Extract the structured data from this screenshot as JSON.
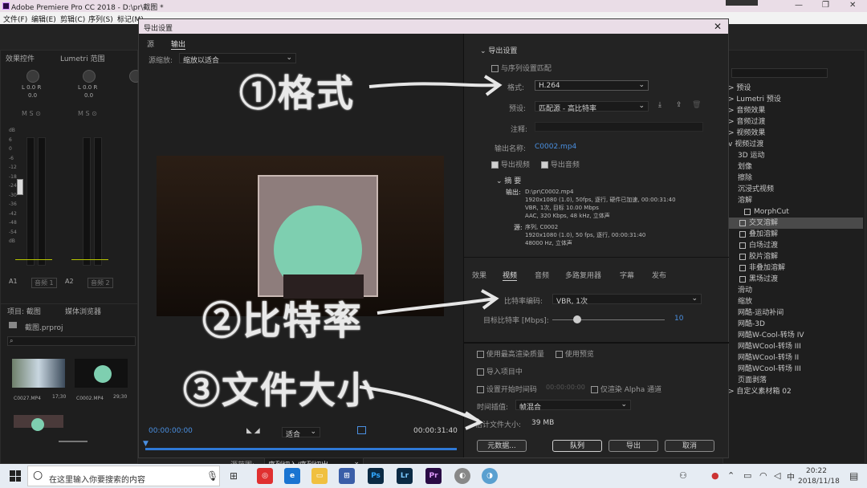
{
  "window": {
    "title": "Adobe Premiere Pro CC 2018 - D:\\pr\\截图 *"
  },
  "menu": [
    "文件(F)",
    "编辑(E)",
    "剪辑(C)",
    "序列(S)",
    "标记(M)"
  ],
  "left_panel": {
    "tabs": [
      "效果控件",
      "Lumetri 范围"
    ],
    "channels": [
      {
        "knob": "L 0.0 R",
        "value": "0.0",
        "label": "A1",
        "btn": "音频 1"
      },
      {
        "knob": "L 0.0 R",
        "value": "0.0",
        "label": "A2",
        "btn": "音频 2"
      },
      {
        "knob": "L 0.0 R",
        "value": "0.0",
        "label": "",
        "btn": ""
      }
    ],
    "db_scale": [
      "dB",
      "6",
      "0",
      "-6",
      "-12",
      "-18",
      "-24",
      "-30",
      "-36",
      "-42",
      "-48",
      "-54",
      "dB"
    ],
    "project_tabs": [
      "项目: 截图",
      "媒体浏览器"
    ],
    "project_name": "截图.prproj",
    "thumbs": [
      {
        "name": "C0027.MP4",
        "dur": "17;30"
      },
      {
        "name": "C0002.MP4",
        "dur": "29;30"
      }
    ]
  },
  "right_panel": {
    "effects": [
      "预设",
      "Lumetri 预设",
      "音频效果",
      "音频过渡",
      "视频效果",
      "视频过渡",
      "3D 运动",
      "划像",
      "擦除",
      "沉浸式视频",
      "溶解",
      "MorphCut",
      "交叉溶解",
      "叠加溶解",
      "白场过渡",
      "胶片溶解",
      "非叠加溶解",
      "黑场过渡",
      "滑动",
      "缩放",
      "网酷-运动补间",
      "网酷-3D",
      "网酷W-Cool-转场 IV",
      "网酷WCool-转场 III",
      "网酷WCool-转场 II",
      "网酷WCool-转场 III",
      "页面剥落",
      "自定义素材箱 02"
    ]
  },
  "dialog": {
    "title": "导出设置",
    "close": "✕",
    "tabs": [
      "源",
      "输出"
    ],
    "source_scale_label": "源缩放:",
    "source_scale_value": "缩放以适合",
    "timecode_in": "00:00:00:00",
    "timecode_out": "00:00:31:40",
    "fit_value": "适合",
    "source_range_label": "源范围:",
    "source_range_value": "序列切入/序列切出",
    "export_settings": {
      "header": "导出设置",
      "match_sequence": "与序列设置匹配",
      "format_label": "格式:",
      "format_value": "H.264",
      "preset_label": "预设:",
      "preset_value": "匹配源 - 高比特率",
      "comment_label": "注释:",
      "output_name_label": "输出名称:",
      "output_name_value": "C0002.mp4",
      "export_video": "导出视频",
      "export_audio": "导出音频",
      "summary_label": "摘 要",
      "output_label": "输出:",
      "output_lines": [
        "D:\\pr\\C0002.mp4",
        "1920x1080 (1.0), 50fps, 逐行, 硬件已加速, 00:00:31:40",
        "VBR, 1次, 目标 10.00 Mbps",
        "AAC, 320 Kbps, 48 kHz, 立体声"
      ],
      "source_label": "源:",
      "source_lines": [
        "序列, C0002",
        "1920x1080 (1.0), 50 fps, 逐行, 00:00:31:40",
        "48000 Hz, 立体声"
      ]
    },
    "output_tabs": [
      "效果",
      "视频",
      "音频",
      "多路复用器",
      "字幕",
      "发布"
    ],
    "bitrate_label": "比特率编码:",
    "bitrate_value": "VBR, 1次",
    "target_bitrate_label": "目标比特率 [Mbps]:",
    "target_bitrate_value": "10",
    "options": {
      "max_render": "使用最高渲染质量",
      "use_preview": "使用预览",
      "import_project": "导入项目中",
      "set_start_tc": "设置开始时间码",
      "start_tc_value": "00:00:00:00",
      "alpha_only": "仅渲染 Alpha 通道",
      "time_interp_label": "时间插值:",
      "time_interp_value": "帧混合",
      "est_size_label": "估计文件大小:",
      "est_size_value": "39 MB"
    },
    "buttons": {
      "metadata": "元数据...",
      "queue": "队列",
      "export": "导出",
      "cancel": "取消"
    }
  },
  "annotations": {
    "a1": "①格式",
    "a2": "②比特率",
    "a3": "③文件大小"
  },
  "taskbar": {
    "search_placeholder": "在这里输入你要搜索的内容",
    "time": "20:22",
    "date": "2018/11/18",
    "lang": "中",
    "apps": [
      "Ps",
      "Lr",
      "Pr"
    ]
  },
  "colors": {
    "accent": "#2f79d6",
    "mint": "#7ecfb0",
    "timeline_blue": "#2680eb"
  }
}
